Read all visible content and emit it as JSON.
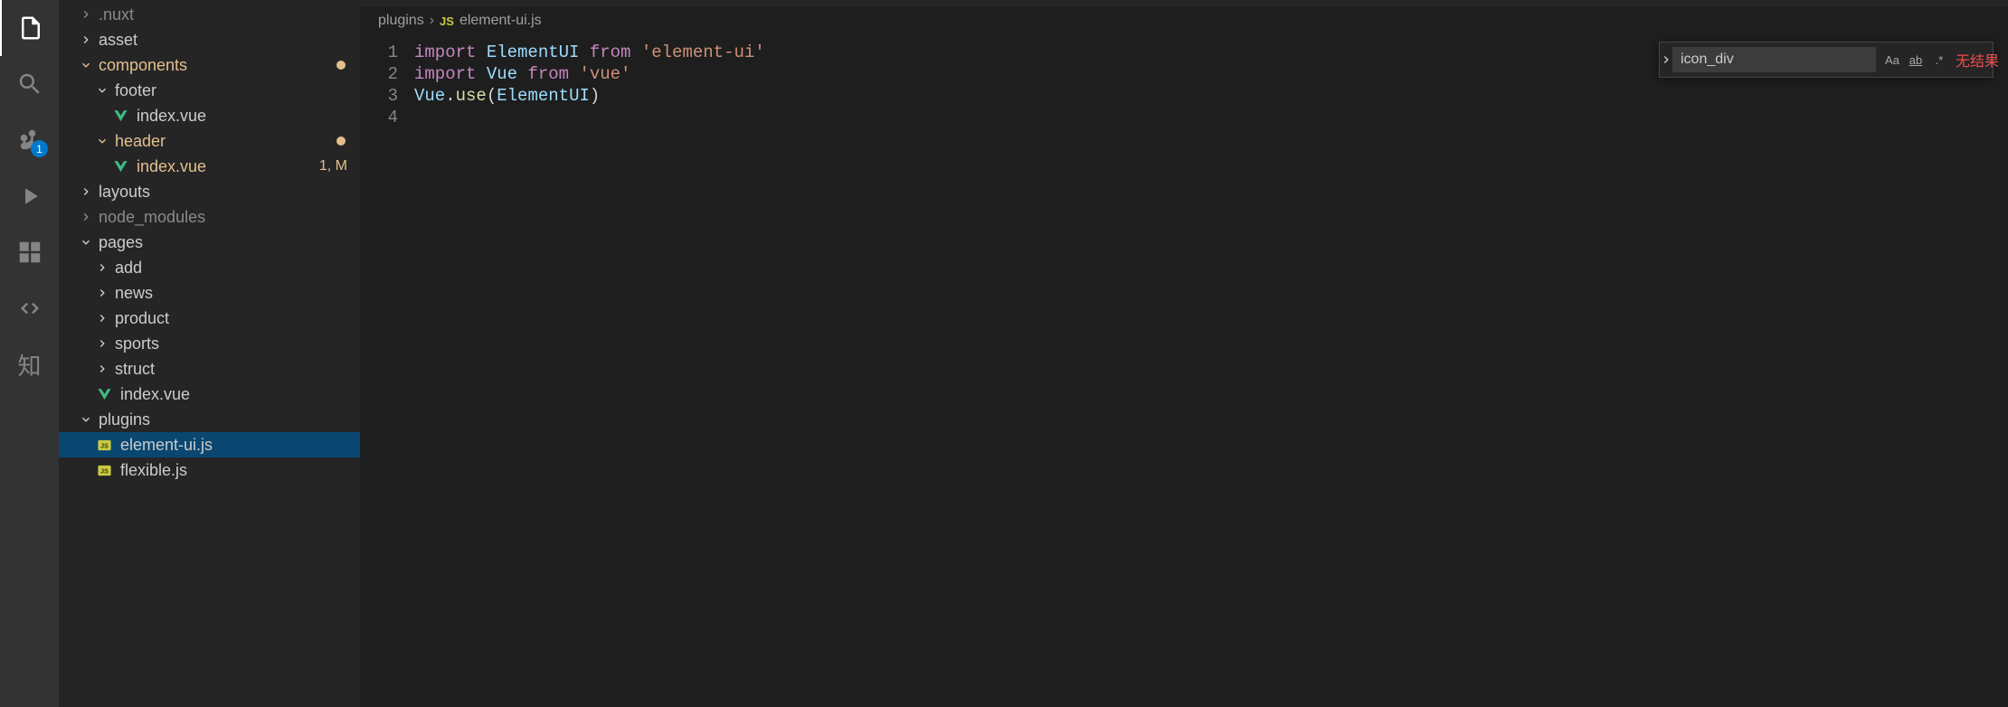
{
  "activity": {
    "scm_badge": "1"
  },
  "sidebar": {
    "tree": {
      "nuxt": ".nuxt",
      "asset": "asset",
      "components": "components",
      "footer": "footer",
      "footer_index": "index.vue",
      "header": "header",
      "header_index": "index.vue",
      "header_index_status": "1, M",
      "layouts": "layouts",
      "node_modules": "node_modules",
      "pages": "pages",
      "pages_add": "add",
      "pages_news": "news",
      "pages_product": "product",
      "pages_sports": "sports",
      "pages_struct": "struct",
      "pages_index": "index.vue",
      "plugins": "plugins",
      "plugins_element": "element-ui.js",
      "plugins_flexible": "flexible.js"
    }
  },
  "breadcrumbs": {
    "root": "plugins",
    "icon_label": "JS",
    "file": "element-ui.js"
  },
  "editor": {
    "lines": {
      "n1": "1",
      "n2": "2",
      "n3": "3",
      "n4": "4"
    },
    "l1": {
      "kw": "import",
      "cls": " ElementUI ",
      "from": "from",
      "str": " 'element-ui'"
    },
    "l2": {
      "kw": "import",
      "cls": " Vue ",
      "from": "from",
      "str": " 'vue'"
    },
    "l3": {
      "obj": "Vue",
      "dot": ".",
      "fn": "use",
      "op": "(",
      "arg": "ElementUI",
      "cp": ")"
    }
  },
  "find": {
    "value": "icon_div",
    "opt_case": "Aa",
    "opt_word": "ab",
    "opt_regex": ".*",
    "result": "无结果"
  }
}
